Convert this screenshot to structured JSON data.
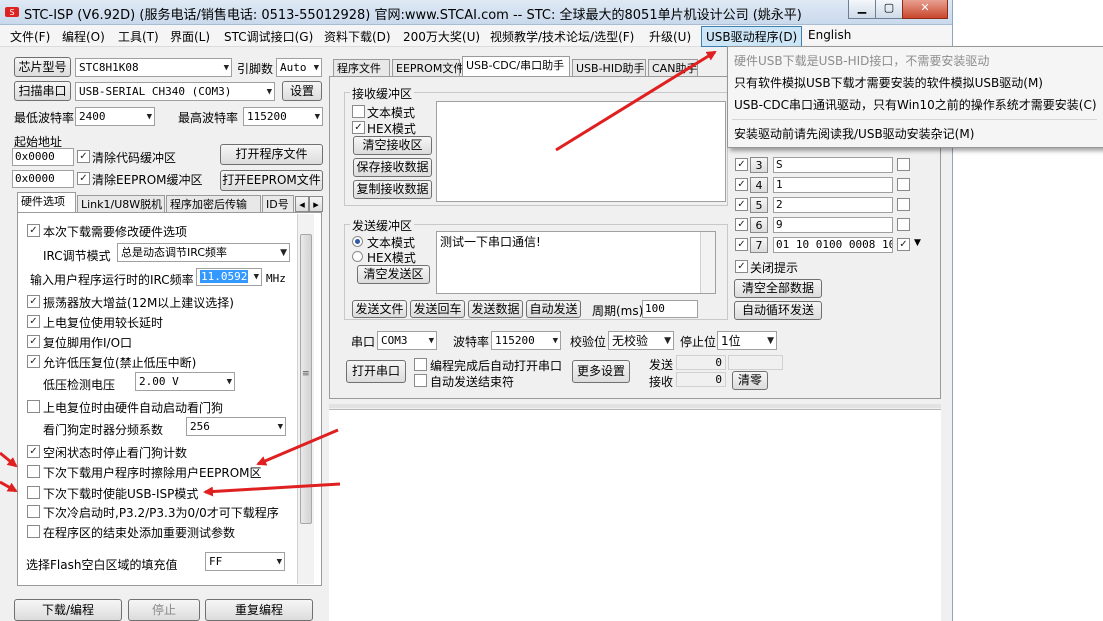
{
  "window": {
    "title": "STC-ISP (V6.92D) (服务电话/销售电话: 0513-55012928) 官网:www.STCAI.com  -- STC: 全球最大的8051单片机设计公司 (姚永平)",
    "minimize": "▁",
    "maximize": "▢",
    "close": "✕"
  },
  "menu": {
    "items": [
      "文件(F)",
      "编程(O)",
      "工具(T)",
      "界面(L)",
      "STC调试接口(G)",
      "资料下载(D)",
      "200万大奖(U)",
      "视频教学/技术论坛/选型(F)",
      "升级(U)",
      "USB驱动程序(D)",
      "English"
    ],
    "active_index": 9
  },
  "dropdown": {
    "items": [
      {
        "label": "硬件USB下载是USB-HID接口，不需要安装驱动",
        "disabled": true
      },
      {
        "label": "只有软件模拟USB下载才需要安装的软件模拟USB驱动(M)",
        "disabled": false
      },
      {
        "label": "USB-CDC串口通讯驱动，只有Win10之前的操作系统才需要安装(C)",
        "disabled": false
      },
      {
        "label": "安装驱动前请先阅读我/USB驱动安装杂记(M)",
        "disabled": false
      }
    ]
  },
  "left": {
    "chip_label": "芯片型号",
    "chip_value": "STC8H1K08",
    "pins_label": "引脚数",
    "pins_value": "Auto",
    "scan_button": "扫描串口",
    "port_value": "USB-SERIAL CH340 (COM3)",
    "settings_button": "设置",
    "min_baud_label": "最低波特率",
    "min_baud_value": "2400",
    "max_baud_label": "最高波特率",
    "max_baud_value": "115200",
    "start_addr_label": "起始地址",
    "addr1": "0x0000",
    "clear_code_label": "清除代码缓冲区",
    "open_program_button": "打开程序文件",
    "addr2": "0x0000",
    "clear_eeprom_label": "清除EEPROM缓冲区",
    "open_eeprom_button": "打开EEPROM文件",
    "tabs": [
      "硬件选项",
      "Link1/U8W脱机",
      "程序加密后传输",
      "ID号"
    ],
    "download_button": "下载/编程",
    "stop_button": "停止",
    "reprogram_button": "重复编程"
  },
  "hw": {
    "opt_modify": "本次下载需要修改硬件选项",
    "irc_mode_label": "IRC调节模式",
    "irc_mode_value": "总是动态调节IRC频率",
    "freq_label": "输入用户程序运行时的IRC频率",
    "freq_value": "11.0592",
    "freq_unit": "MHz",
    "opt_osc": "振荡器放大增益(12M以上建议选择)",
    "opt_delay": "上电复位使用较长延时",
    "opt_reset": "复位脚用作I/O口",
    "opt_lvr": "允许低压复位(禁止低压中断)",
    "lvd_label": "低压检测电压",
    "lvd_value": "2.00 V",
    "opt_wdt": "上电复位时由硬件自动启动看门狗",
    "wdt_label": "看门狗定时器分频系数",
    "wdt_value": "256",
    "opt_idle": "空闲状态时停止看门狗计数",
    "opt_erase": "下次下载用户程序时擦除用户EEPROM区",
    "opt_usbisp": "下次下载时使能USB-ISP模式",
    "opt_p32": "下次冷启动时,P3.2/P3.3为0/0才可下载程序",
    "opt_test": "在程序区的结束处添加重要测试参数",
    "flash_fill_label": "选择Flash空白区域的填充值",
    "flash_fill_value": "FF"
  },
  "right": {
    "tabs": [
      "程序文件",
      "EEPROM文件",
      "USB-CDC/串口助手",
      "USB-HID助手",
      "CAN助手"
    ],
    "recv_group": "接收缓冲区",
    "text_mode": "文本模式",
    "hex_mode": "HEX模式",
    "clear_recv": "清空接收区",
    "save_recv": "保存接收数据",
    "copy_recv": "复制接收数据",
    "send_group": "发送缓冲区",
    "send_text": "测试一下串口通信!",
    "clear_send": "清空发送区",
    "send_file": "发送文件",
    "send_return": "发送回车",
    "send_data": "发送数据",
    "auto_send": "自动发送",
    "period_label": "周期(ms)",
    "period_value": "100",
    "port_label": "串口",
    "port_value": "COM3",
    "baud_label": "波特率",
    "baud_value": "115200",
    "parity_label": "校验位",
    "parity_value": "无校验",
    "stop_label": "停止位",
    "stop_value": "1位",
    "open_port": "打开串口",
    "auto_open": "编程完成后自动打开串口",
    "auto_end": "自动发送结束符",
    "more_settings": "更多设置",
    "sent_label": "发送",
    "sent_value": "0",
    "recv_label": "接收",
    "recv_value": "0",
    "clear_counts": "清零",
    "multi": [
      {
        "num": "3",
        "value": "S"
      },
      {
        "num": "4",
        "value": "1"
      },
      {
        "num": "5",
        "value": "2"
      },
      {
        "num": "6",
        "value": "9"
      },
      {
        "num": "7",
        "value": "01 10 0100 0008 10 :"
      }
    ],
    "close_tips": "关闭提示",
    "clear_all": "清空全部数据",
    "auto_loop": "自动循环发送"
  },
  "colors": {
    "annotation_arrow": "#e02020",
    "selection_highlight": "#3399ff",
    "menu_active_bg": "#cde6f7"
  }
}
